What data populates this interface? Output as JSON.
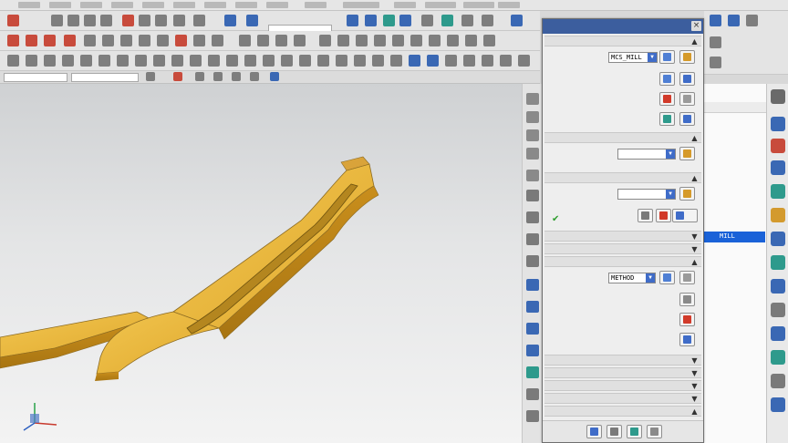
{
  "dialog": {
    "geometry_value": "MCS_MILL",
    "method_value": "METHOD"
  },
  "navigator": {
    "selected_row": "MILL"
  },
  "colors": {
    "title_bar": "#3c5e9e",
    "part": "#e8b43a",
    "selection": "#1a62d8"
  },
  "icons": [
    "close-icon",
    "chevron-down-icon",
    "checkmark-icon",
    "specify-part-icon",
    "specify-check-icon",
    "cut-region-icon",
    "drive-method-icon",
    "projection-vector-icon",
    "cutting-params-icon",
    "non-cutting-moves-icon",
    "feeds-speeds-icon",
    "generate-icon",
    "replay-icon",
    "verify-icon",
    "list-icon"
  ]
}
